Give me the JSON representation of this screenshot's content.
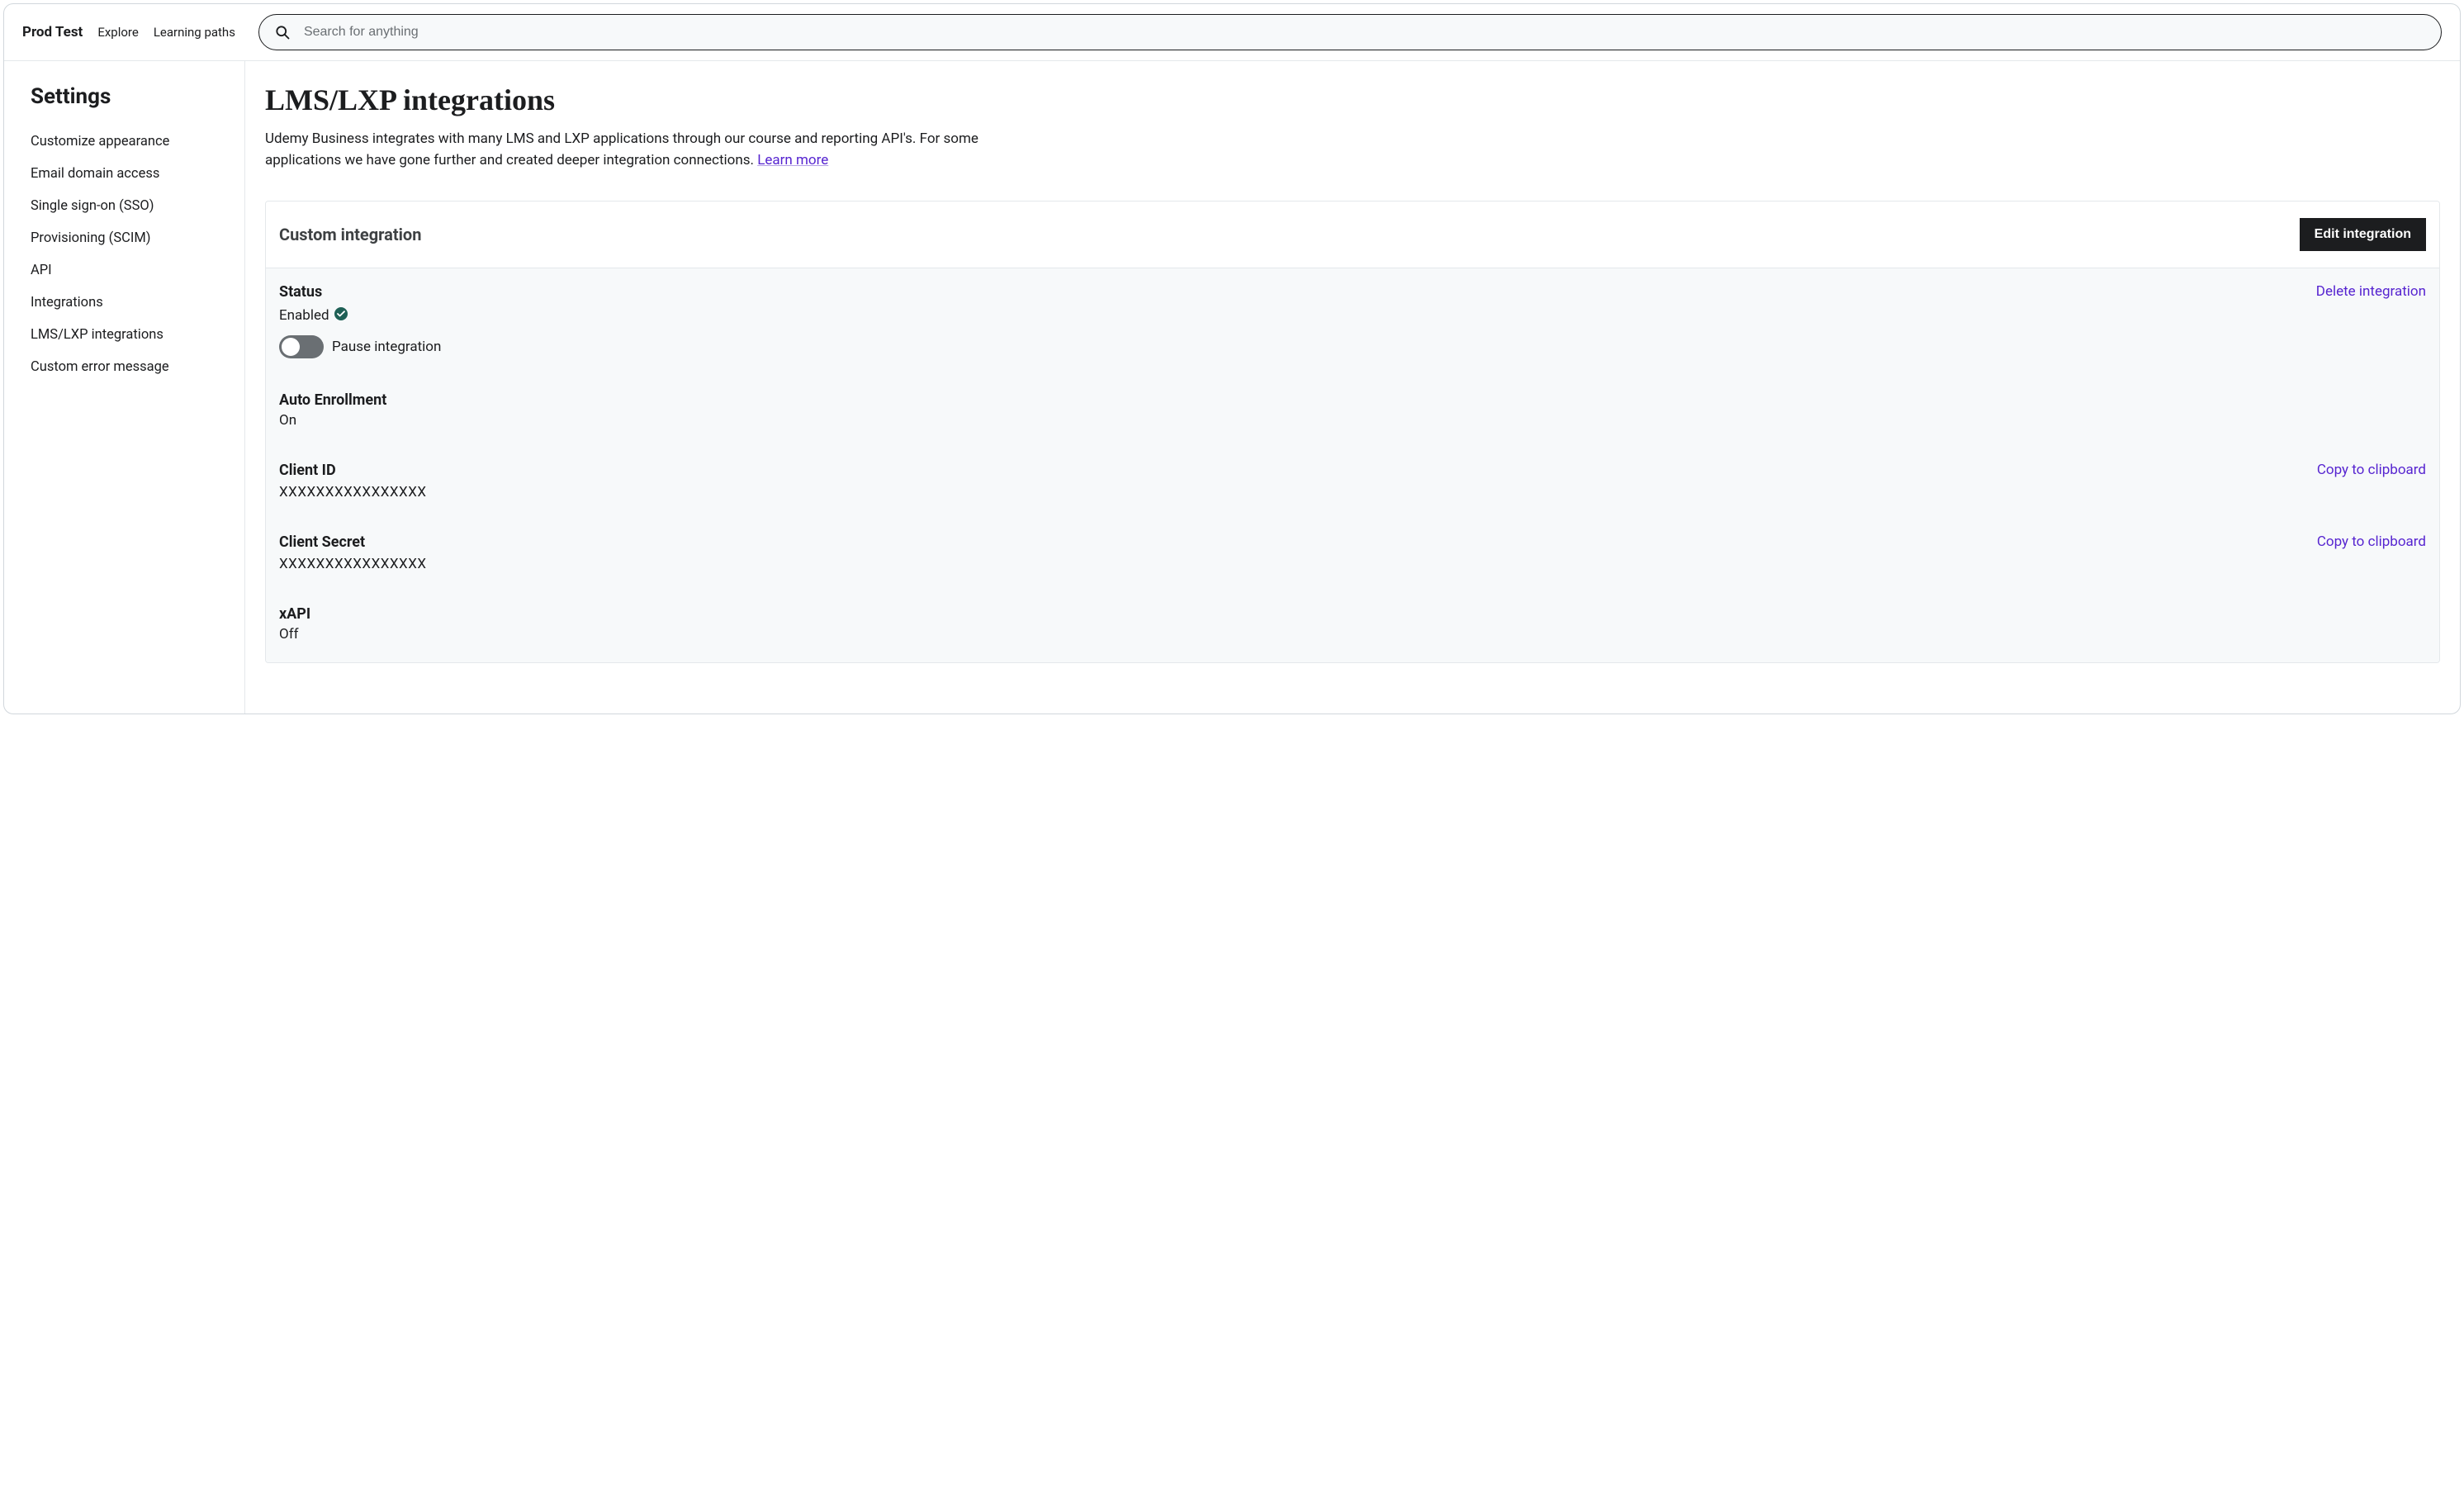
{
  "header": {
    "brand": "Prod Test",
    "nav": {
      "explore": "Explore",
      "learning_paths": "Learning paths"
    },
    "search_placeholder": "Search for anything"
  },
  "sidebar": {
    "title": "Settings",
    "items": [
      {
        "label": "Customize appearance"
      },
      {
        "label": "Email domain access"
      },
      {
        "label": "Single sign-on (SSO)"
      },
      {
        "label": "Provisioning (SCIM)"
      },
      {
        "label": "API"
      },
      {
        "label": "Integrations"
      },
      {
        "label": "LMS/LXP integrations"
      },
      {
        "label": "Custom error message"
      }
    ]
  },
  "main": {
    "title": "LMS/LXP integrations",
    "desc_part1": "Udemy Business integrates with many LMS and LXP applications through our course and reporting API's. For some applications we have gone further and created deeper integration connections. ",
    "learn_more": "Learn more",
    "card": {
      "title": "Custom integration",
      "edit_label": "Edit integration",
      "status": {
        "label": "Status",
        "value": "Enabled",
        "pause_label": "Pause integration",
        "delete_label": "Delete integration"
      },
      "auto_enroll": {
        "label": "Auto Enrollment",
        "value": "On"
      },
      "client_id": {
        "label": "Client ID",
        "value": "XXXXXXXXXXXXXXXX",
        "copy_label": "Copy to clipboard"
      },
      "client_secret": {
        "label": "Client Secret",
        "value": "XXXXXXXXXXXXXXXX",
        "copy_label": "Copy to clipboard"
      },
      "xapi": {
        "label": "xAPI",
        "value": "Off"
      }
    }
  }
}
